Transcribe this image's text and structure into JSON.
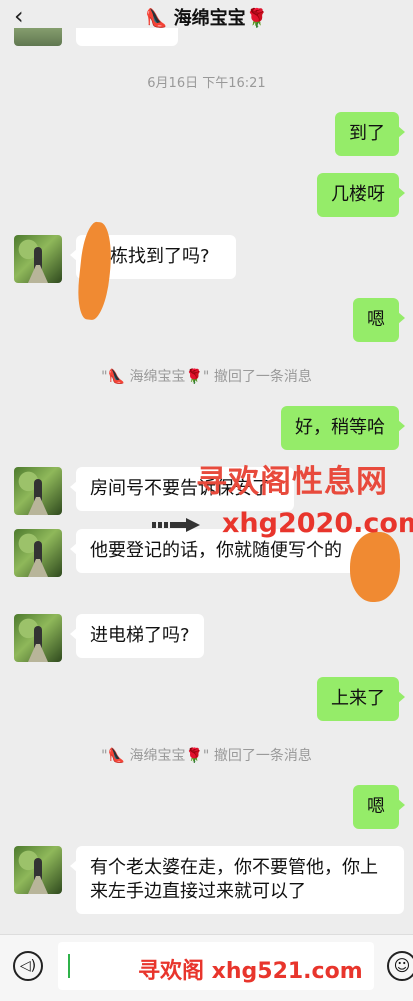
{
  "header": {
    "back_icon": "‹",
    "title": "👠 海绵宝宝🌹"
  },
  "messages": [
    {
      "type": "time",
      "text": "6月16日 下午16:21"
    },
    {
      "type": "me",
      "text": "到了"
    },
    {
      "type": "me",
      "text": "几楼呀"
    },
    {
      "type": "other",
      "text": "栋找到了吗?"
    },
    {
      "type": "me",
      "text": "嗯"
    },
    {
      "type": "system",
      "text": "\"👠 海绵宝宝🌹\" 撤回了一条消息"
    },
    {
      "type": "me",
      "text": "好，稍等哈"
    },
    {
      "type": "other",
      "text": "房间号不要告诉保安了"
    },
    {
      "type": "other",
      "text": "他要登记的话，你就随便写个的"
    },
    {
      "type": "other",
      "text": "进电梯了吗?"
    },
    {
      "type": "me",
      "text": "上来了"
    },
    {
      "type": "system",
      "text": "\"👠 海绵宝宝🌹\" 撤回了一条消息"
    },
    {
      "type": "me",
      "text": "嗯"
    },
    {
      "type": "other",
      "text": "有个老太婆在走，你不要管他，你上来左手边直接过来就可以了"
    }
  ],
  "watermarks": {
    "top": "寻欢阁性息网",
    "middle": "xhg2020.com",
    "bottom": "寻欢阁 xhg521.com"
  },
  "inputbar": {
    "voice_icon": "voice-icon",
    "emoji_icon": "emoji-icon"
  },
  "colors": {
    "background": "#ededed",
    "my_bubble": "#95ec69",
    "their_bubble": "#ffffff",
    "watermark": "#e8352c"
  }
}
